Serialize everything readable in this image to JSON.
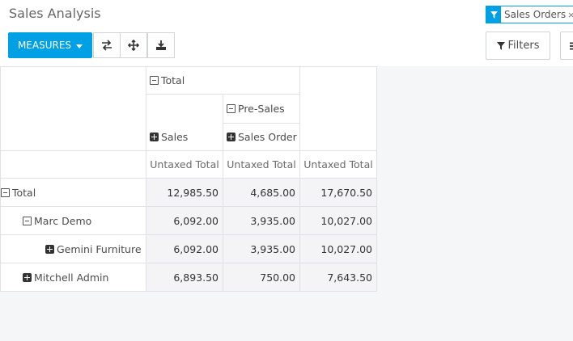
{
  "header": {
    "title": "Sales Analysis",
    "measures_label": "MEASURES",
    "facet_label": "Sales Orders",
    "facet_remove": "×",
    "filters_label": "Filters"
  },
  "icons": [
    "flip-axis-icon",
    "expand-all-icon",
    "download-icon",
    "filter-icon",
    "group-by-icon"
  ],
  "colors": {
    "accent": "#00A0E4"
  },
  "pivot": {
    "col_header_total": "Total",
    "col_header_presales": "Pre-Sales",
    "col_header_sales": "Sales",
    "col_header_sales_order": "Sales Order",
    "measures": [
      "Untaxed Total",
      "Untaxed Total",
      "Untaxed Total"
    ],
    "rows": [
      {
        "label": "Total",
        "values": [
          "12,985.50",
          "4,685.00",
          "17,670.50"
        ]
      },
      {
        "label": "Marc Demo",
        "values": [
          "6,092.00",
          "3,935.00",
          "10,027.00"
        ]
      },
      {
        "label": "Gemini Furniture",
        "values": [
          "6,092.00",
          "3,935.00",
          "10,027.00"
        ]
      },
      {
        "label": "Mitchell Admin",
        "values": [
          "6,893.50",
          "750.00",
          "7,643.50"
        ]
      }
    ]
  }
}
